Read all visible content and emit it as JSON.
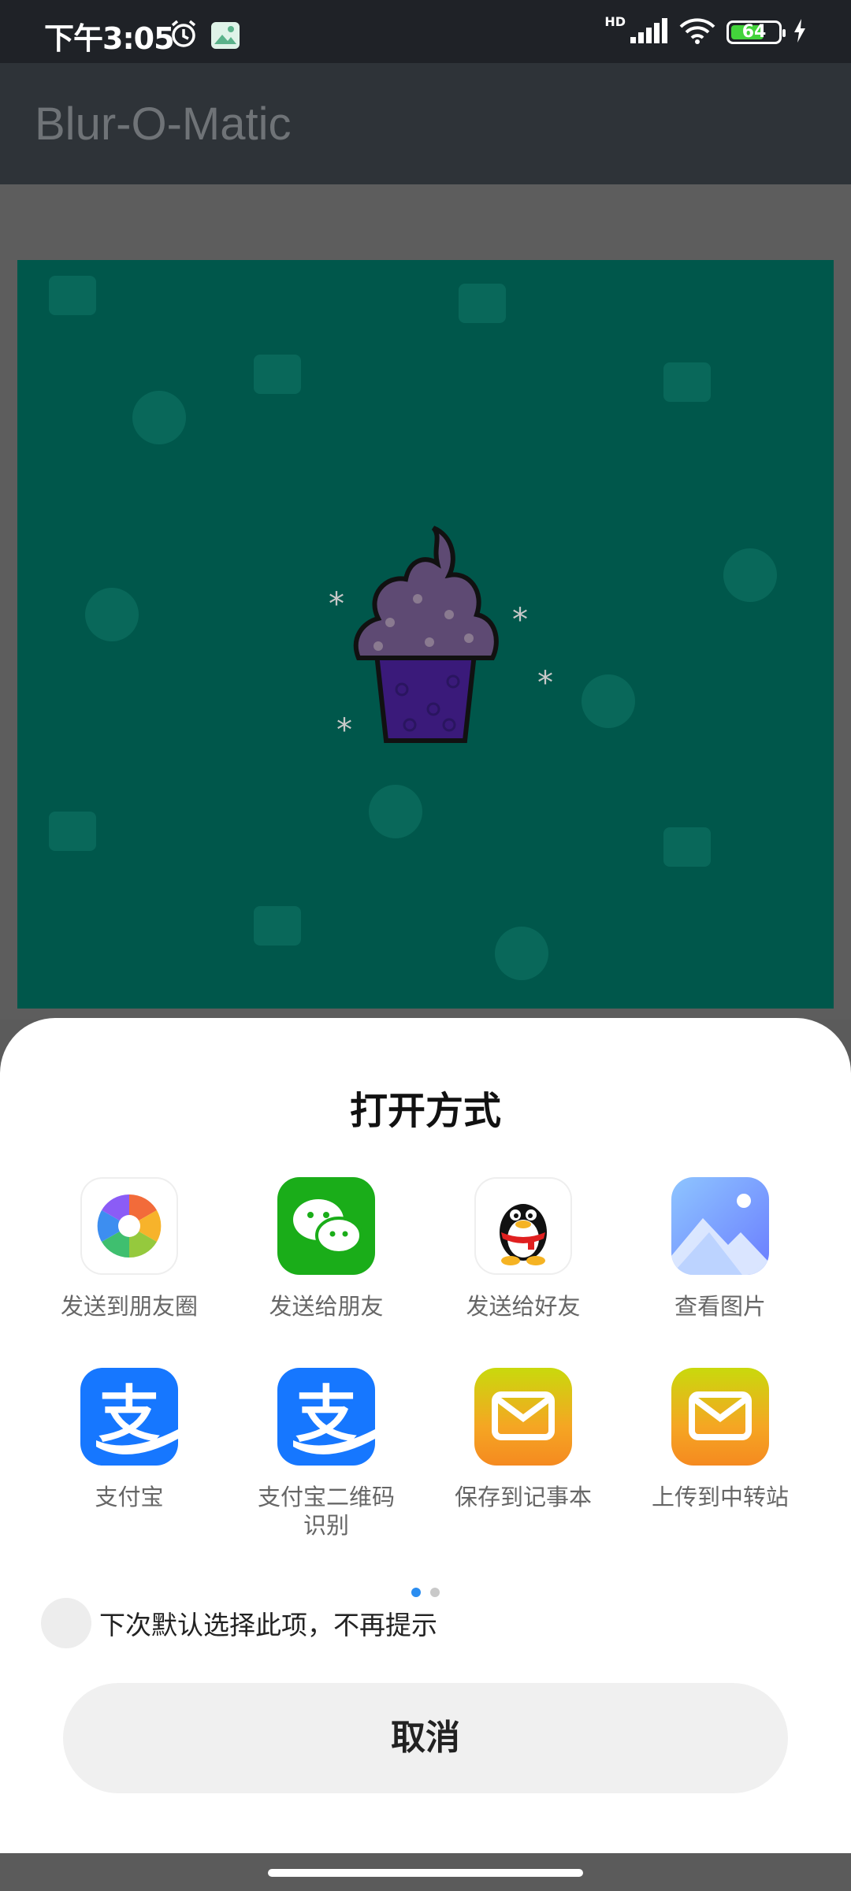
{
  "status_bar": {
    "time": "下午3:05",
    "network": "HD",
    "battery": "64"
  },
  "app_bar": {
    "title": "Blur-O-Matic"
  },
  "sheet": {
    "title": "打开方式",
    "apps": [
      {
        "label": "发送到朋友圈",
        "icon": "moments-icon"
      },
      {
        "label": "发送给朋友",
        "icon": "wechat-icon"
      },
      {
        "label": "发送给好友",
        "icon": "qq-icon"
      },
      {
        "label": "查看图片",
        "icon": "gallery-icon"
      },
      {
        "label": "支付宝",
        "icon": "alipay-icon"
      },
      {
        "label": "支付宝二维码识别",
        "icon": "alipay-qr-icon"
      },
      {
        "label": "保存到记事本",
        "icon": "mail-notepad-icon"
      },
      {
        "label": "上传到中转站",
        "icon": "mail-transfer-icon"
      }
    ],
    "page_indicator": {
      "pages": 2,
      "active": 1
    },
    "default_option_label": "下次默认选择此项，不再提示",
    "cancel_label": "取消"
  },
  "colors": {
    "preview_bg": "#00574b",
    "wechat_green": "#1aad19",
    "alipay_blue": "#1677ff",
    "mail_orange": "#f59d24"
  }
}
